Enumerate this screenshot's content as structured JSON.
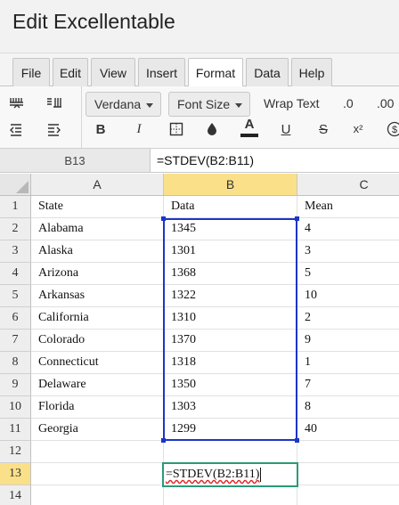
{
  "app": {
    "title": "Edit Excellentable"
  },
  "menu": {
    "items": [
      {
        "label": "File",
        "active": false
      },
      {
        "label": "Edit",
        "active": false
      },
      {
        "label": "View",
        "active": false
      },
      {
        "label": "Insert",
        "active": false
      },
      {
        "label": "Format",
        "active": true
      },
      {
        "label": "Data",
        "active": false
      },
      {
        "label": "Help",
        "active": false
      }
    ]
  },
  "toolbar": {
    "font_family": "Verdana",
    "font_size": "Font Size",
    "wrap_text": "Wrap Text",
    "decrease_decimal": ".0",
    "increase_decimal": ".00",
    "bold": "B",
    "italic": "I",
    "underline": "U",
    "strike": "S",
    "superscript": "x²",
    "currency": "$"
  },
  "formula_bar": {
    "cell_ref": "B13",
    "formula": "=STDEV(B2:B11)"
  },
  "grid": {
    "columns": [
      "A",
      "B",
      "C"
    ],
    "selected_column": "B",
    "rows": [
      {
        "n": "1",
        "a": "State",
        "b": "Data",
        "c": "Mean"
      },
      {
        "n": "2",
        "a": "Alabama",
        "b": "1345",
        "c": "4"
      },
      {
        "n": "3",
        "a": "Alaska",
        "b": "1301",
        "c": "3"
      },
      {
        "n": "4",
        "a": "Arizona",
        "b": "1368",
        "c": "5"
      },
      {
        "n": "5",
        "a": "Arkansas",
        "b": "1322",
        "c": "10"
      },
      {
        "n": "6",
        "a": "California",
        "b": "1310",
        "c": "2"
      },
      {
        "n": "7",
        "a": "Colorado",
        "b": "1370",
        "c": "9"
      },
      {
        "n": "8",
        "a": "Connecticut",
        "b": "1318",
        "c": "1"
      },
      {
        "n": "9",
        "a": "Delaware",
        "b": "1350",
        "c": "7"
      },
      {
        "n": "10",
        "a": "Florida",
        "b": "1303",
        "c": "8"
      },
      {
        "n": "11",
        "a": "Georgia",
        "b": "1299",
        "c": "40"
      },
      {
        "n": "12",
        "a": "",
        "b": "",
        "c": ""
      },
      {
        "n": "13",
        "a": "",
        "b": "",
        "c": ""
      },
      {
        "n": "14",
        "a": "",
        "b": "",
        "c": ""
      }
    ],
    "editing_cell": {
      "ref": "B13",
      "value": "=STDEV(B2:B11)"
    }
  }
}
